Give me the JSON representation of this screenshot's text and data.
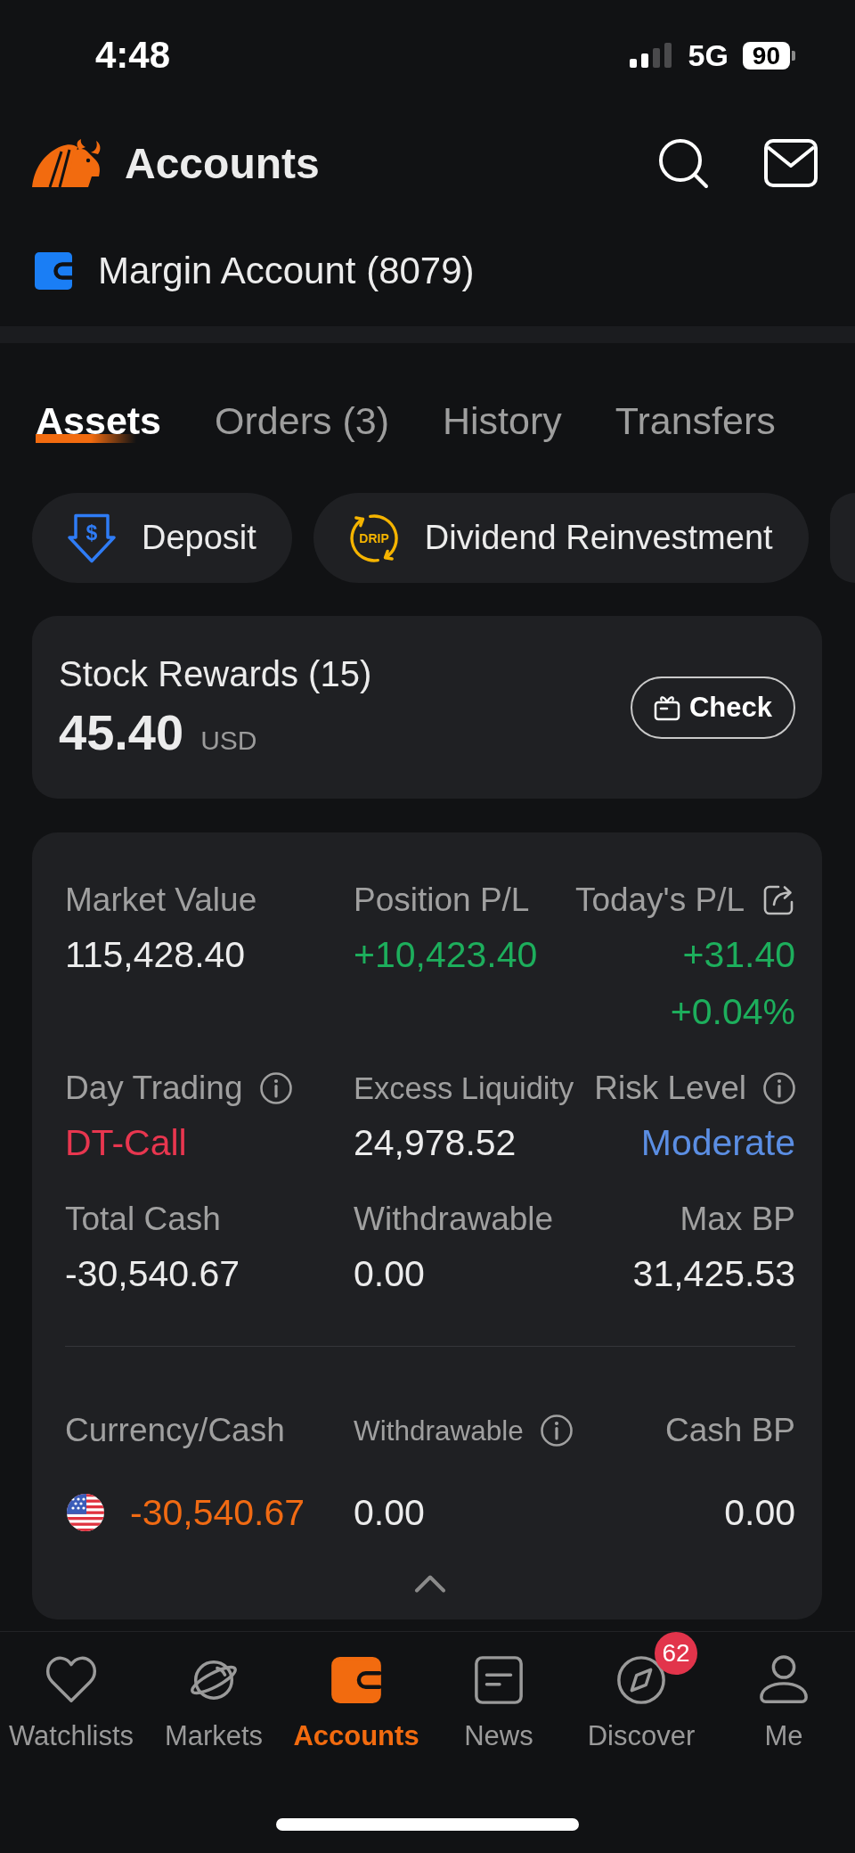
{
  "status_bar": {
    "time": "4:48",
    "network": "5G",
    "battery": "90"
  },
  "header": {
    "title": "Accounts"
  },
  "account": {
    "name": "Margin Account (8079)"
  },
  "tabs": [
    {
      "label": "Assets",
      "selected": true
    },
    {
      "label": "Orders (3)",
      "selected": false
    },
    {
      "label": "History",
      "selected": false
    },
    {
      "label": "Transfers",
      "selected": false
    }
  ],
  "actions": [
    {
      "kind": "deposit",
      "label": "Deposit",
      "icon_text": "$"
    },
    {
      "kind": "drip",
      "label": "Dividend Reinvestment",
      "icon_text": "DRIP"
    },
    {
      "kind": "partial"
    }
  ],
  "rewards": {
    "title": "Stock Rewards (15)",
    "amount": "45.40",
    "currency": "USD",
    "button": "Check"
  },
  "summary": {
    "expanded": true,
    "metrics": [
      {
        "label": "Market Value",
        "values": [
          "115,428.40"
        ],
        "color": "#ececec",
        "info": false,
        "share": false
      },
      {
        "label": "Position P/L",
        "values": [
          "+10,423.40"
        ],
        "color": "#1dae5c",
        "info": false,
        "share": false
      },
      {
        "label": "Today's P/L",
        "values": [
          "+31.40",
          "+0.04%"
        ],
        "color": "#1dae5c",
        "info": false,
        "share": true
      },
      {
        "label": "Day Trading",
        "values": [
          "DT-Call"
        ],
        "color": "#e8364f",
        "info": true,
        "share": false
      },
      {
        "label": "Excess Liquidity",
        "values": [
          "24,978.52"
        ],
        "color": "#ececec",
        "info": false,
        "share": false
      },
      {
        "label": "Risk Level",
        "values": [
          "Moderate"
        ],
        "color": "#5b8ee3",
        "info": true,
        "share": false
      },
      {
        "label": "Total Cash",
        "values": [
          "-30,540.67"
        ],
        "color": "#ececec",
        "info": false,
        "share": false
      },
      {
        "label": "Withdrawable",
        "values": [
          "0.00"
        ],
        "color": "#ececec",
        "info": false,
        "share": false
      },
      {
        "label": "Max BP",
        "values": [
          "31,425.53"
        ],
        "color": "#ececec",
        "info": false,
        "share": false
      }
    ],
    "cash_table": {
      "columns": [
        {
          "label": "Currency/Cash",
          "info": false
        },
        {
          "label": "Withdrawable",
          "info": true
        },
        {
          "label": "Cash BP",
          "info": false
        }
      ],
      "rows": [
        {
          "cells": [
            {
              "text": "-30,540.67",
              "color": "#f06a13"
            },
            {
              "text": "0.00",
              "color": "#ececec"
            },
            {
              "text": "0.00",
              "color": "#ececec"
            }
          ]
        }
      ]
    }
  },
  "bottom_nav": [
    {
      "kind": "watchlists",
      "label": "Watchlists",
      "selected": false
    },
    {
      "kind": "markets",
      "label": "Markets",
      "selected": false
    },
    {
      "kind": "accounts",
      "label": "Accounts",
      "selected": true
    },
    {
      "kind": "news",
      "label": "News",
      "selected": false
    },
    {
      "kind": "discover",
      "label": "Discover",
      "selected": false,
      "badge": "62"
    },
    {
      "kind": "me",
      "label": "Me",
      "selected": false
    }
  ]
}
